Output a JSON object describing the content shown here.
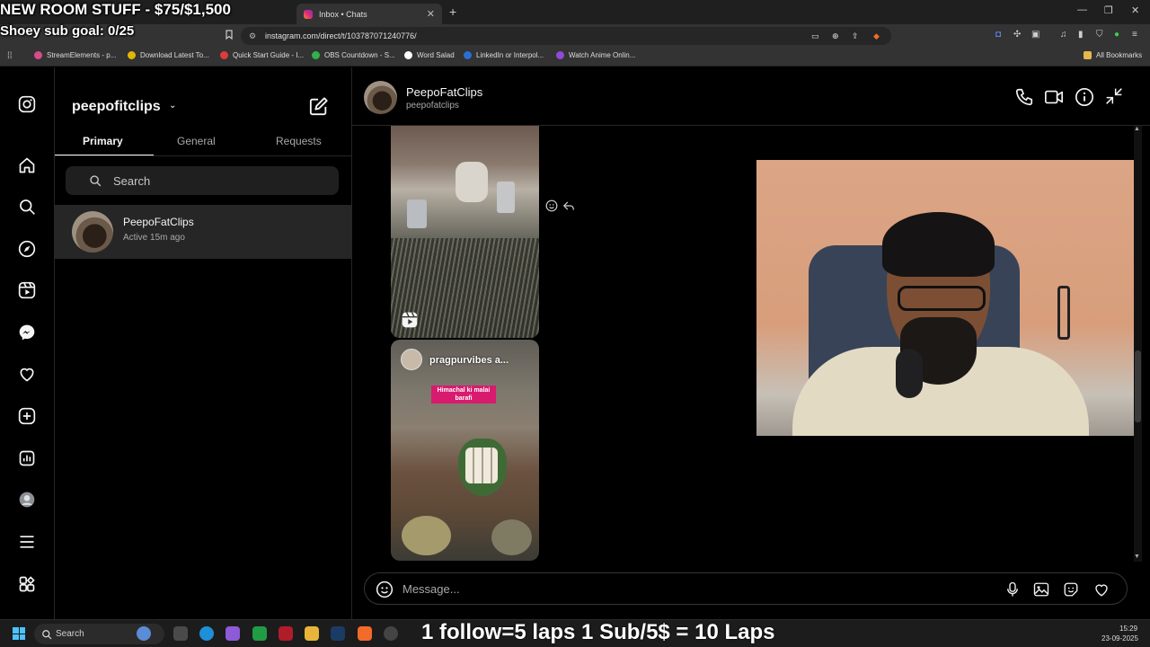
{
  "overlay": {
    "goal_text": "NEW ROOM STUFF - $75/$1,500",
    "sub_goal": "Shoey sub goal: 0/25",
    "bottom_banner": "1 follow=5 laps 1 Sub/5$ = 10 Laps"
  },
  "browser": {
    "tabs": [
      {
        "label": "",
        "active": false
      },
      {
        "label": "Inbox • Chats",
        "active": true
      }
    ],
    "url": "instagram.com/direct/t/103787071240776/",
    "bookmarks": [
      {
        "label": "StreamElements - p...",
        "color": "#d64b8c"
      },
      {
        "label": "Download Latest To...",
        "color": "#e2b500"
      },
      {
        "label": "Quick Start Guide - I...",
        "color": "#e03a3a"
      },
      {
        "label": "OBS Countdown - S...",
        "color": "#2fb24a"
      },
      {
        "label": "Word Salad",
        "color": "#ffffff"
      },
      {
        "label": "LinkedIn or Interpol...",
        "color": "#2a6fd6"
      },
      {
        "label": "Watch Anime Onlin...",
        "color": "#8f4ad8"
      }
    ],
    "all_bookmarks": "All Bookmarks"
  },
  "inbox": {
    "account": "peepofitclips",
    "tabs": [
      "Primary",
      "General",
      "Requests"
    ],
    "active_tab": "Primary",
    "search_placeholder": "Search",
    "chats": [
      {
        "name": "PeepoFatClips",
        "status": "Active 15m ago"
      }
    ]
  },
  "conversation": {
    "name": "PeepoFatClips",
    "username": "peepofatclips",
    "shared_post": {
      "user": "pragpurvibes a...",
      "caption": "Himachal ki malai barafi"
    },
    "message_placeholder": "Message..."
  },
  "taskbar": {
    "search_label": "Search",
    "time": "15:29",
    "date": "23-09-2025"
  },
  "colors": {
    "background": "#000000",
    "surface": "#262626",
    "text_primary": "#f5f5f5",
    "text_secondary": "#a8a8a8",
    "caption_pink": "#d81b6f"
  }
}
